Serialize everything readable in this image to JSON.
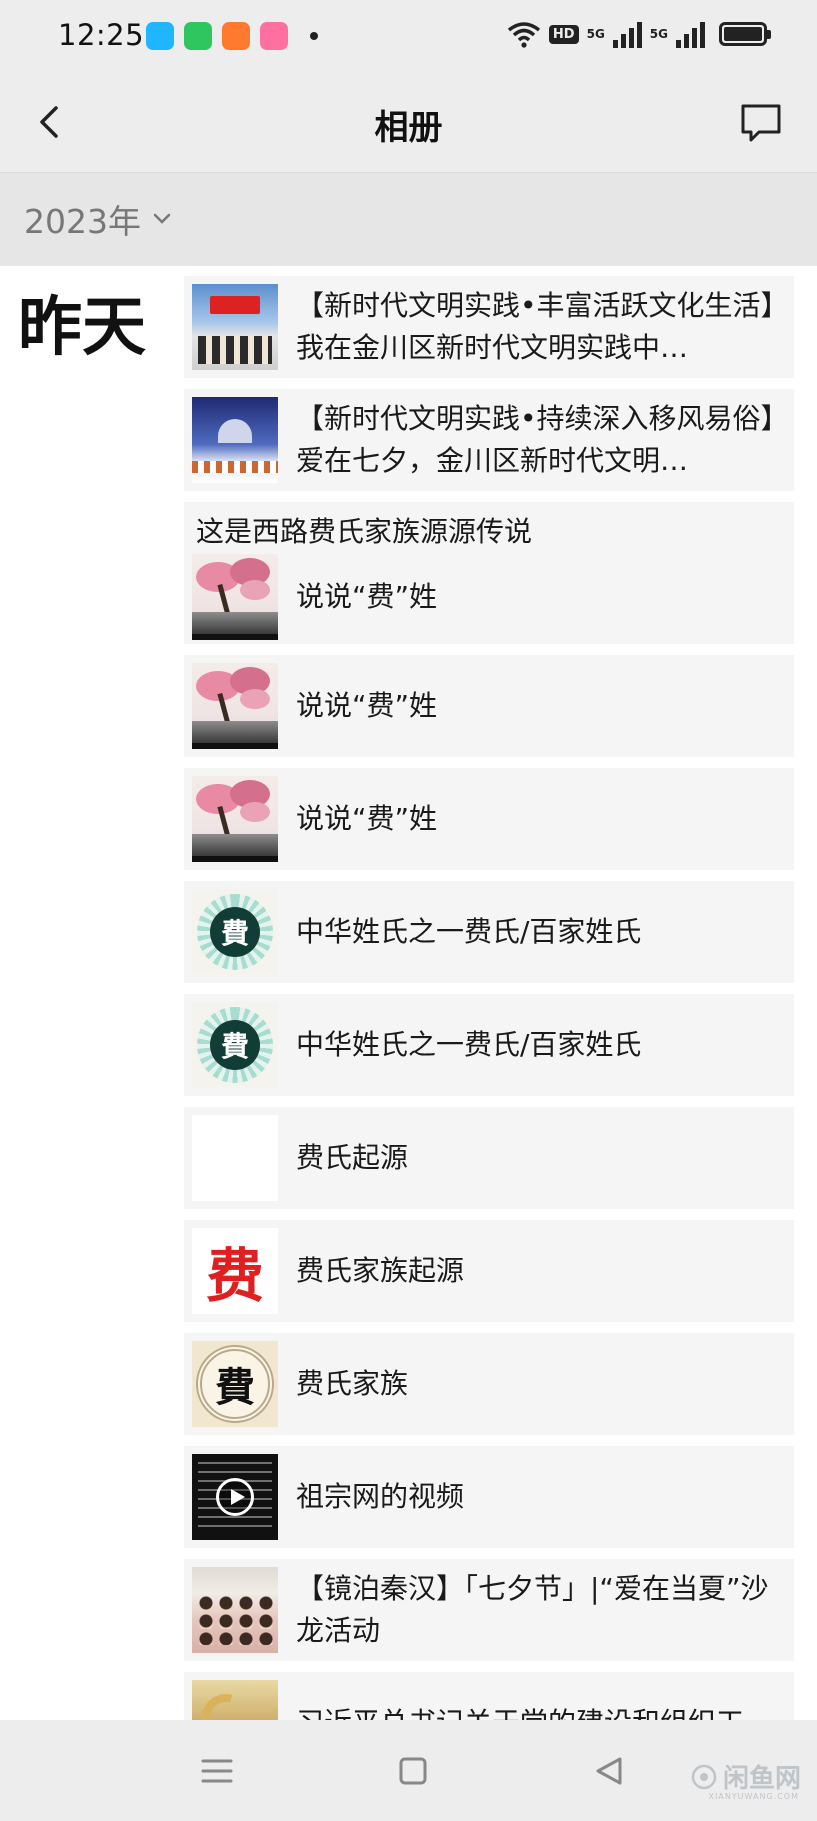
{
  "status_bar": {
    "time": "12:25",
    "hd_label": "HD",
    "network_1": "5G",
    "network_2": "5G",
    "app_icons": [
      {
        "name": "qq-icon",
        "color": "#1fb5ff"
      },
      {
        "name": "iqiyi-icon",
        "color": "#2fc55f"
      },
      {
        "name": "kuaishou-icon",
        "color": "#ff5a2f"
      },
      {
        "name": "bilibili-icon",
        "color": "#ff6fa0"
      }
    ]
  },
  "header": {
    "title": "相册"
  },
  "year_filter": {
    "label": "2023年"
  },
  "day_group": {
    "label": "昨天"
  },
  "items": [
    {
      "title": "【新时代文明实践•丰富活跃文化生活】我在金川区新时代文明实践中…"
    },
    {
      "title": "【新时代文明实践•持续深入移风易俗】爱在七夕，金川区新时代文明…"
    },
    {
      "group_title": "这是西路费氏家族源源传说",
      "title": "说说“费”姓"
    },
    {
      "title": "说说“费”姓"
    },
    {
      "title": "说说“费”姓"
    },
    {
      "title": "中华姓氏之一费氏/百家姓氏",
      "thumb_char": "費"
    },
    {
      "title": "中华姓氏之一费氏/百家姓氏",
      "thumb_char": "費"
    },
    {
      "title": "费氏起源"
    },
    {
      "title": "费氏家族起源",
      "thumb_char": "费"
    },
    {
      "title": "费氏家族",
      "thumb_char": "費"
    },
    {
      "title": "祖宗网的视频"
    },
    {
      "title": "【镜泊秦汉】「七夕节」|“爱在当夏”沙龙活动"
    },
    {
      "title": "习近平总书记关于党的建设和组织工"
    }
  ],
  "watermark": {
    "text": "闲鱼网",
    "sub": "XIANYUWANG.COM"
  },
  "colors": {
    "background": "#ededed",
    "card": "#f5f5f5",
    "text": "#1a1a1a"
  }
}
